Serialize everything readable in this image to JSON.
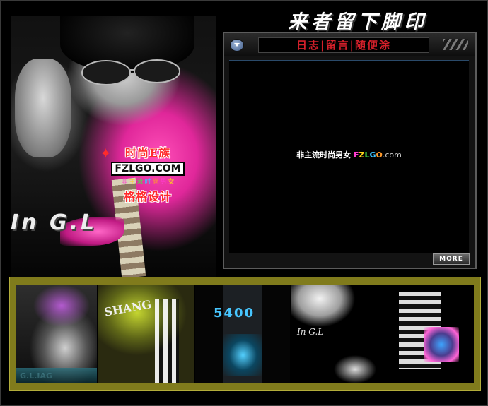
{
  "heading": "来者留下脚印",
  "window": {
    "title": "日志|留言|随便涂",
    "body_text_prefix": "非主流时尚男女",
    "brand_letters": [
      "F",
      "Z",
      "L",
      "G",
      "O"
    ],
    "brand_suffix": ".com",
    "more_button": "MORE"
  },
  "hero": {
    "logo_top": "时尚E族",
    "logo_main": "FZLGO.COM",
    "logo_sub_chars": [
      "非",
      "主",
      "流",
      "时",
      "尚",
      "男",
      "女"
    ],
    "logo_bottom": "格格设计",
    "graffiti": "In G.L"
  },
  "thumbnails": [
    {
      "label": "G.L.IAG"
    },
    {
      "label": "SHANG"
    },
    {
      "label": "5400"
    },
    {
      "label": "In G.L"
    },
    {
      "label": ""
    }
  ],
  "colors": {
    "strip": "#807b1c",
    "accent_pink": "#e0279a",
    "title_red": "#d4202a"
  }
}
